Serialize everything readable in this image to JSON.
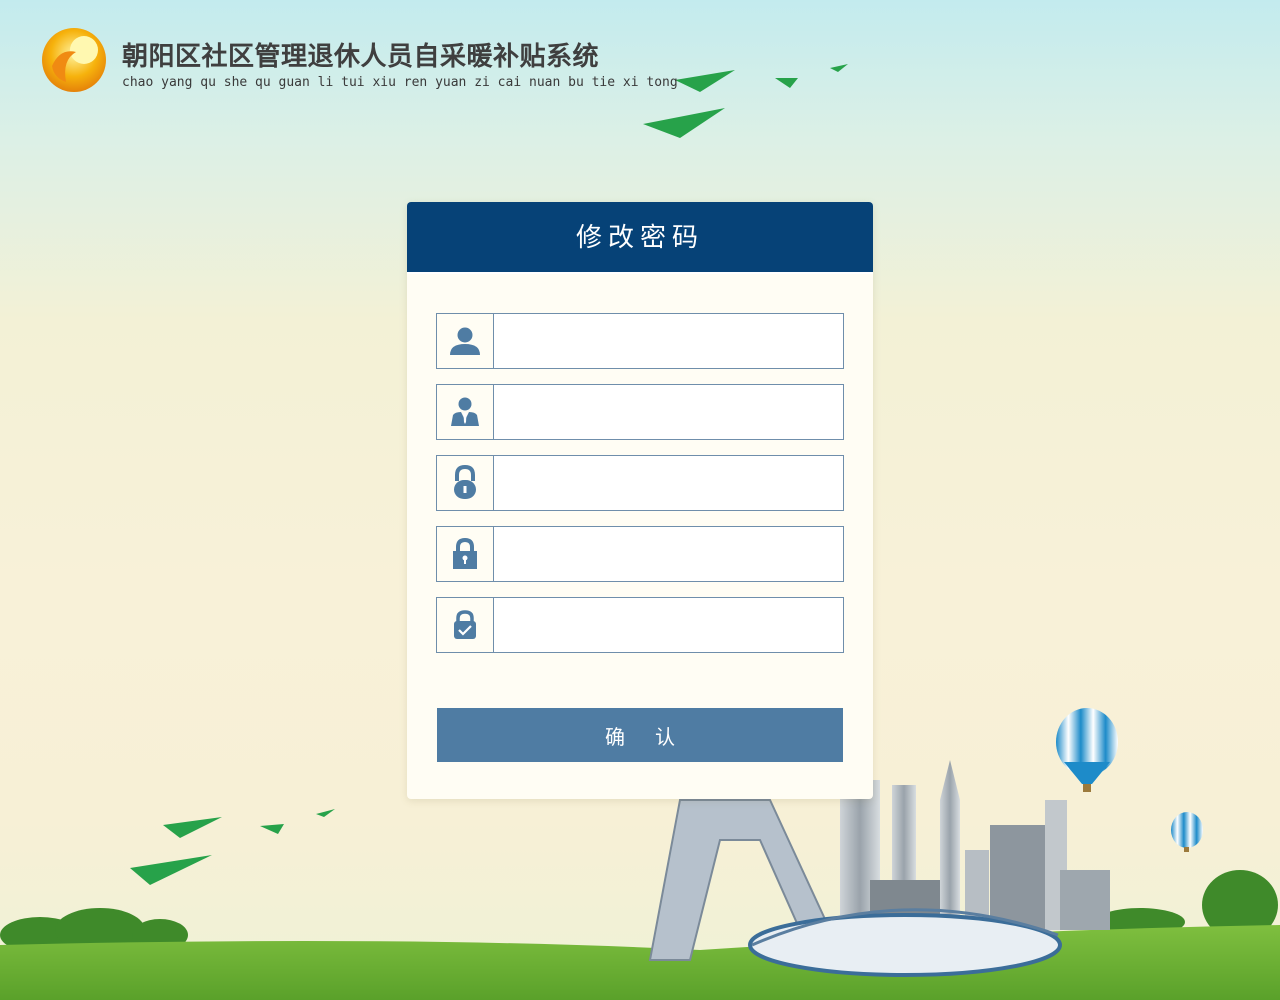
{
  "header": {
    "title": "朝阳区社区管理退休人员自采暖补贴系统",
    "pinyin": "chao yang qu she qu guan li tui xiu ren yuan zi cai nuan bu tie xi tong"
  },
  "form": {
    "title": "修改密码",
    "fields": [
      {
        "icon": "user-icon",
        "value": "",
        "placeholder": ""
      },
      {
        "icon": "person-suit-icon",
        "value": "",
        "placeholder": ""
      },
      {
        "icon": "padlock-icon",
        "value": "",
        "placeholder": ""
      },
      {
        "icon": "lock-icon",
        "value": "",
        "placeholder": ""
      },
      {
        "icon": "lock-check-icon",
        "value": "",
        "placeholder": ""
      }
    ],
    "confirm_label": "确认"
  },
  "colors": {
    "header_bar": "#064277",
    "button": "#4f7ca3",
    "icon": "#4f7ca3",
    "border": "#6f8eab"
  }
}
